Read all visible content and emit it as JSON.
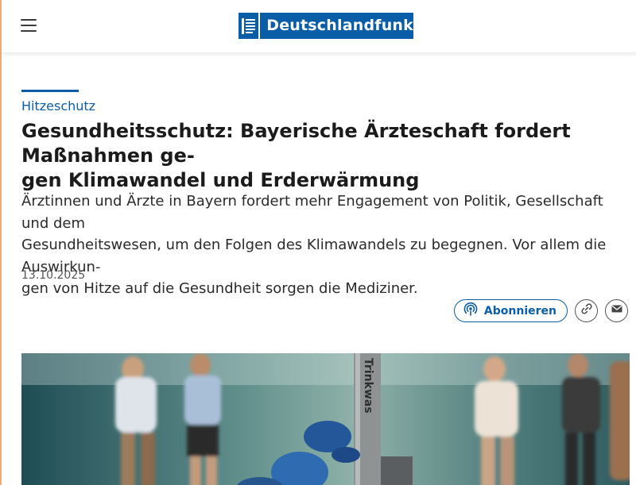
{
  "header": {
    "logo_text": "Deutschlandfunk"
  },
  "article": {
    "kicker": "Hitzeschutz",
    "headline_line1": "Gesundheitsschutz: Bayerische Ärzteschaft fordert Maßnahmen ge-",
    "headline_line2": "gen Klimawandel und Erderwärmung",
    "teaser_line1": "Ärztinnen und Ärzte in Bayern fordert mehr Engagement von Politik, Gesellschaft und dem",
    "teaser_line2": "Gesundheitswesen, um den Folgen des Klimawandels zu begegnen. Vor allem die Auswirkun-",
    "teaser_line3": "gen von Hitze auf die Gesundheit sorgen die Mediziner.",
    "date": "13.10.2025"
  },
  "actions": {
    "subscribe_label": "Abonnieren",
    "icons": [
      "podcast-icon",
      "link-icon",
      "mail-icon"
    ]
  },
  "photo": {
    "sign_text": "Trinkwas"
  },
  "colors": {
    "brand_blue": "#0a5ea8",
    "accent_left_border": "#e7a978",
    "text": "#1b1b1b"
  }
}
